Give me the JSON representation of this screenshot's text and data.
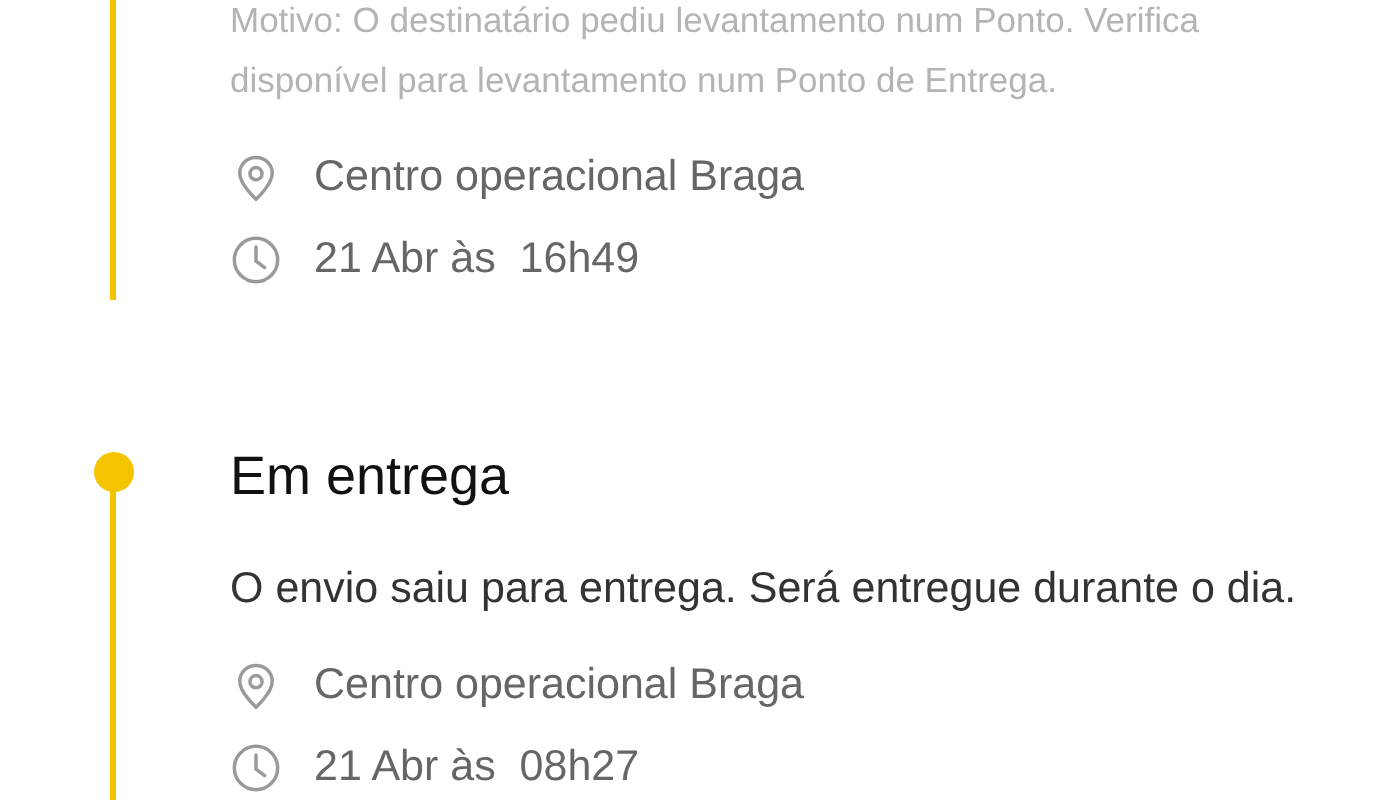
{
  "events": [
    {
      "muted": true,
      "description_lines": [
        "Motivo: O destinatário pediu levantamento num Ponto. Verifica",
        "disponível para levantamento num Ponto de Entrega."
      ],
      "location": "Centro operacional Braga",
      "time": "21 Abr às  16h49"
    },
    {
      "title": "Em entrega",
      "muted": false,
      "description_lines": [
        "O envio saiu para entrega. Será entregue durante o dia."
      ],
      "location": "Centro operacional Braga",
      "time": "21 Abr às  08h27"
    }
  ]
}
